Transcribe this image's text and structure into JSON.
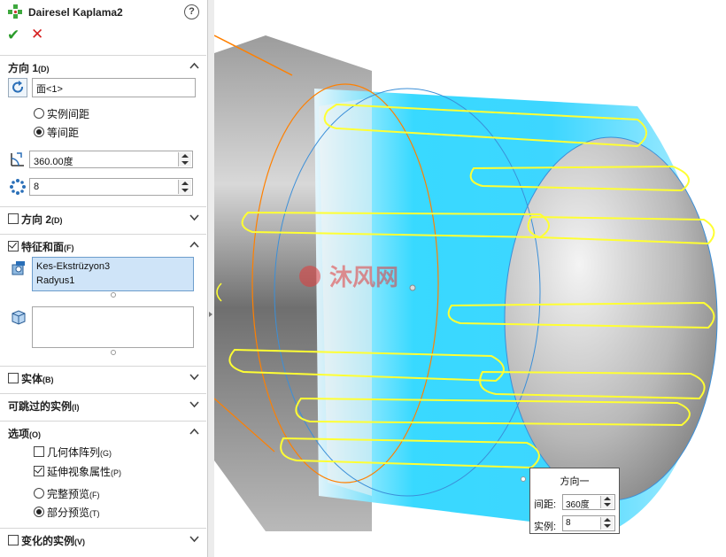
{
  "feature": {
    "title": "Dairesel Kaplama2"
  },
  "direction1": {
    "header": "方向 1",
    "header_key": "(D)",
    "face_value": "面<1>",
    "spacing_options": [
      {
        "label": "实例间距",
        "selected": false
      },
      {
        "label": "等间距",
        "selected": true
      }
    ],
    "angle_value": "360.00度",
    "count_value": "8"
  },
  "direction2": {
    "header": "方向 2",
    "header_key": "(D)",
    "checked": false
  },
  "features_faces": {
    "header": "特征和面",
    "header_key": "(F)",
    "checked": true,
    "features": [
      "Kes-Ekstrüzyon3",
      "Radyus1"
    ]
  },
  "bodies": {
    "header": "实体",
    "header_key": "(B)",
    "checked": false
  },
  "skip_instances": {
    "header": "可跳过的实例",
    "header_key": "(I)"
  },
  "options": {
    "header": "选项",
    "header_key": "(O)",
    "geometry_pattern": {
      "label": "几何体阵列",
      "key": "(G)",
      "checked": false
    },
    "propagate_visual": {
      "label": "延伸视象属性",
      "key": "(P)",
      "checked": true
    },
    "full_preview": {
      "label": "完整预览",
      "key": "(F)",
      "selected": false
    },
    "partial_preview": {
      "label": "部分预览",
      "key": "(T)",
      "selected": true
    }
  },
  "vary_instances": {
    "header": "变化的实例",
    "header_key": "(V)",
    "checked": false
  },
  "callout": {
    "title": "方向一",
    "spacing_label": "间距:",
    "spacing_value": "360度",
    "count_label": "实例:",
    "count_value": "8"
  },
  "colors": {
    "selection": "#00e5ff",
    "edge": "#ffff33",
    "sketch": "#ff8000",
    "axis": "#3b8fd8"
  }
}
